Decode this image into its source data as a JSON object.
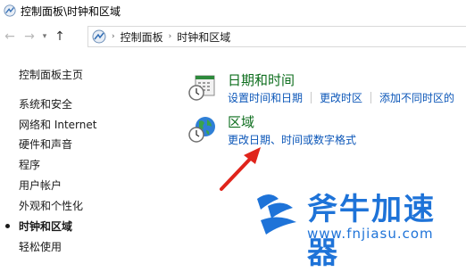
{
  "window": {
    "title": "控制面板\\时钟和区域"
  },
  "nav": {
    "back_icon": "arrow-left-icon",
    "forward_icon": "arrow-right-icon",
    "recent_icon": "chevron-down-icon",
    "up_icon": "arrow-up-icon"
  },
  "address": {
    "crumbs": [
      "控制面板",
      "时钟和区域"
    ],
    "separator": "›"
  },
  "sidebar": {
    "items": [
      {
        "label": "控制面板主页",
        "current": false
      },
      {
        "label": "系统和安全",
        "current": false
      },
      {
        "label": "网络和 Internet",
        "current": false
      },
      {
        "label": "硬件和声音",
        "current": false
      },
      {
        "label": "程序",
        "current": false
      },
      {
        "label": "用户帐户",
        "current": false
      },
      {
        "label": "外观和个性化",
        "current": false
      },
      {
        "label": "时钟和区域",
        "current": true
      },
      {
        "label": "轻松使用",
        "current": false
      }
    ]
  },
  "sections": [
    {
      "title": "日期和时间",
      "icon": "calendar-clock-icon",
      "links": [
        "设置时间和日期",
        "更改时区",
        "添加不同时区的"
      ]
    },
    {
      "title": "区域",
      "icon": "globe-clock-icon",
      "links": [
        "更改日期、时间或数字格式"
      ]
    }
  ],
  "annotation": {
    "arrow_color": "#e0241b"
  },
  "watermark": {
    "name": "斧牛加速器",
    "url": "www.fnjiasu.com",
    "color": "#1e73d8"
  },
  "colors": {
    "heading": "#0e6e1e",
    "link": "#0b56b8"
  }
}
